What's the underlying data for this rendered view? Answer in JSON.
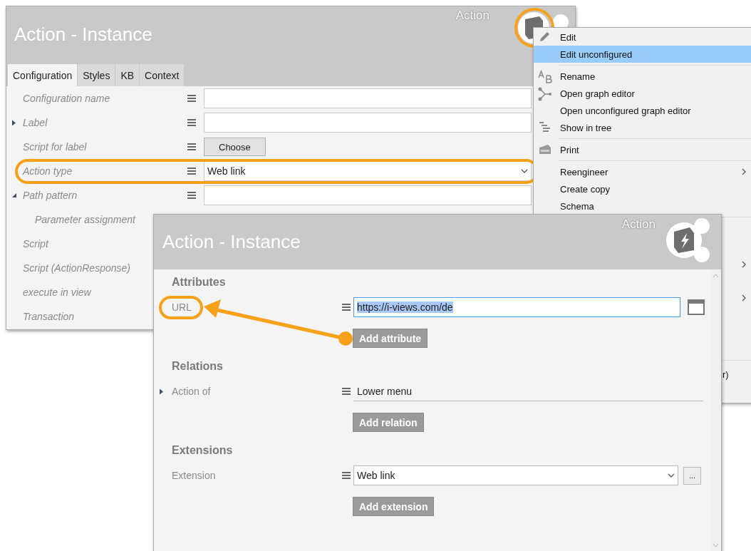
{
  "back_window": {
    "title": "Action - Instance",
    "type_label": "Action",
    "icon_highlighted": true,
    "tabs": [
      {
        "label": "Configuration",
        "selected": true
      },
      {
        "label": "Styles",
        "selected": false
      },
      {
        "label": "KB",
        "selected": false
      },
      {
        "label": "Context",
        "selected": false
      }
    ],
    "rows": [
      {
        "label": "Configuration name",
        "kind": "text",
        "highlighted": false
      },
      {
        "label": "Label",
        "kind": "text",
        "expanded": false,
        "highlighted": false
      },
      {
        "label": "Script for label",
        "kind": "button",
        "button": "Choose",
        "highlighted": false
      },
      {
        "label": "Action type",
        "kind": "dropdown",
        "value": "Web link",
        "highlighted": true
      },
      {
        "label": "Path pattern",
        "kind": "text",
        "expanded": true,
        "highlighted": false,
        "children": [
          {
            "label": "Parameter assignment",
            "highlighted": false
          }
        ]
      },
      {
        "label": "Script",
        "highlighted": false
      },
      {
        "label": "Script (ActionResponse)",
        "highlighted": false
      },
      {
        "label": "execute in view",
        "highlighted": false
      },
      {
        "label": "Transaction",
        "highlighted": false
      }
    ]
  },
  "context_menu": {
    "groups": [
      [
        {
          "label": "Edit",
          "selected": false
        },
        {
          "label": "Edit unconfigured",
          "selected": true
        }
      ],
      [
        {
          "label": "Rename",
          "selected": false
        },
        {
          "label": "Open graph editor",
          "selected": false
        },
        {
          "label": "Open unconfigured graph editor",
          "selected": false
        },
        {
          "label": "Show in tree",
          "selected": false
        }
      ],
      [
        {
          "label": "Print",
          "selected": false
        }
      ],
      [
        {
          "label": "Reengineer",
          "selected": false,
          "submenu": true
        },
        {
          "label": "Create copy",
          "selected": false
        },
        {
          "label": "Schema",
          "selected": false
        }
      ],
      [
        {
          "selected": false,
          "submenu": true
        },
        {
          "selected": false,
          "submenu": true
        }
      ],
      [
        {
          "label": "r)",
          "selected": false
        }
      ]
    ]
  },
  "front_window": {
    "title": "Action - Instance",
    "type_label": "Action",
    "sections": [
      {
        "heading": "Attributes",
        "rows": [
          {
            "label": "URL",
            "kind": "text",
            "value": "https://i-views.com/de",
            "text_selected": true,
            "highlighted": true
          }
        ],
        "add_button": "Add attribute"
      },
      {
        "heading": "Relations",
        "rows": [
          {
            "label": "Action of",
            "kind": "relation",
            "value": "Lower menu",
            "expanded": false,
            "highlighted": false
          }
        ],
        "add_button": "Add relation"
      },
      {
        "heading": "Extensions",
        "rows": [
          {
            "label": "Extension",
            "kind": "dropdown",
            "value": "Web link",
            "more_button": "...",
            "highlighted": false
          }
        ],
        "add_button": "Add extension"
      }
    ]
  }
}
